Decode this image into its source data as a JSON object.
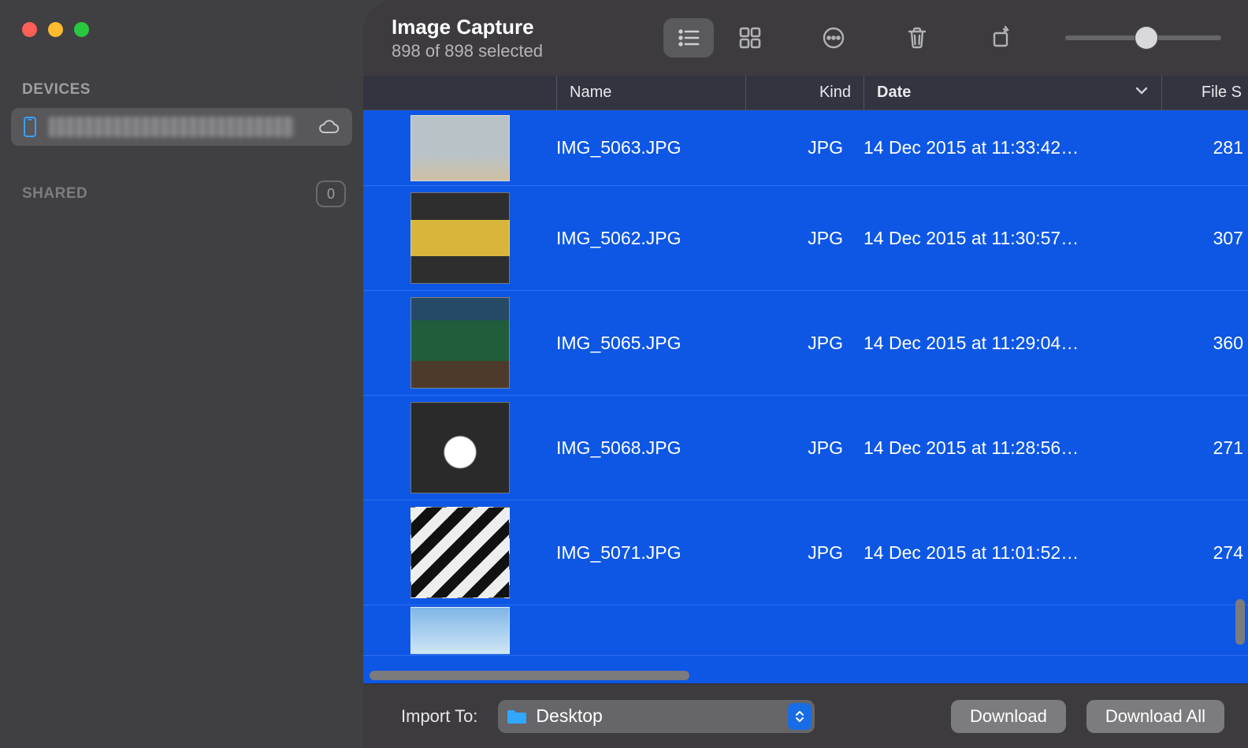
{
  "sidebar": {
    "devices_label": "DEVICES",
    "shared_label": "SHARED",
    "shared_count": "0"
  },
  "app": {
    "title": "Image Capture",
    "subtitle": "898 of 898 selected"
  },
  "columns": {
    "name": "Name",
    "kind": "Kind",
    "date": "Date",
    "size": "File S"
  },
  "rows": [
    {
      "name": "IMG_5063.JPG",
      "kind": "JPG",
      "date": "14 Dec 2015 at 11:33:42…",
      "size": "281"
    },
    {
      "name": "IMG_5062.JPG",
      "kind": "JPG",
      "date": "14 Dec 2015 at 11:30:57…",
      "size": "307"
    },
    {
      "name": "IMG_5065.JPG",
      "kind": "JPG",
      "date": "14 Dec 2015 at 11:29:04…",
      "size": "360"
    },
    {
      "name": "IMG_5068.JPG",
      "kind": "JPG",
      "date": "14 Dec 2015 at 11:28:56…",
      "size": "271"
    },
    {
      "name": "IMG_5071.JPG",
      "kind": "JPG",
      "date": "14 Dec 2015 at 11:01:52…",
      "size": "274"
    }
  ],
  "footer": {
    "import_to": "Import To:",
    "destination": "Desktop",
    "download": "Download",
    "download_all": "Download All"
  }
}
